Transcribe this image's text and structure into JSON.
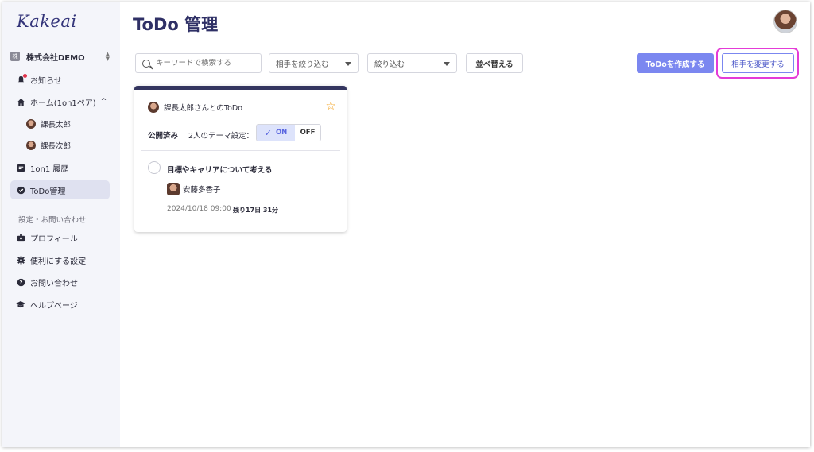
{
  "app": {
    "logo": "Kakeai"
  },
  "sidebar": {
    "org": {
      "icon_text": "株",
      "name": "株式会社DEMO"
    },
    "items": [
      {
        "label": "お知らせ",
        "icon": "bell-icon"
      },
      {
        "label": "ホーム(1on1ペア)",
        "icon": "home-icon"
      },
      {
        "label": "課長太郎",
        "icon": "avatar"
      },
      {
        "label": "課長次郎",
        "icon": "avatar"
      },
      {
        "label": "1on1 履歴",
        "icon": "history-icon"
      },
      {
        "label": "ToDo管理",
        "icon": "check-circle-icon"
      }
    ],
    "section_label": "設定・お問い合わせ",
    "settings": [
      {
        "label": "プロフィール",
        "icon": "profile-icon"
      },
      {
        "label": "便利にする設定",
        "icon": "gear-icon"
      },
      {
        "label": "お問い合わせ",
        "icon": "help-icon"
      },
      {
        "label": "ヘルプページ",
        "icon": "graduation-cap-icon"
      }
    ]
  },
  "header": {
    "title": "ToDo 管理"
  },
  "toolbar": {
    "search_placeholder": "キーワードで検索する",
    "filter_partner": "相手を絞り込む",
    "filter": "絞り込む",
    "sort_label": "並べ替える",
    "create_label": "ToDoを作成する",
    "change_partner_label": "相手を変更する"
  },
  "card": {
    "title": "課長太郎さんとのToDo",
    "status": "公開済み",
    "theme_label": "2人のテーマ設定：",
    "toggle_on": "ON",
    "toggle_off": "OFF",
    "todo": {
      "title": "目標やキャリアについて考える",
      "assignee": "安藤多香子",
      "due": "2024/10/18 09:00",
      "remaining": "残り17日 31分"
    }
  },
  "colors": {
    "accent": "#7b87f0",
    "highlight": "#e43bd7",
    "star": "#f3a11e",
    "brand": "#34357a"
  }
}
